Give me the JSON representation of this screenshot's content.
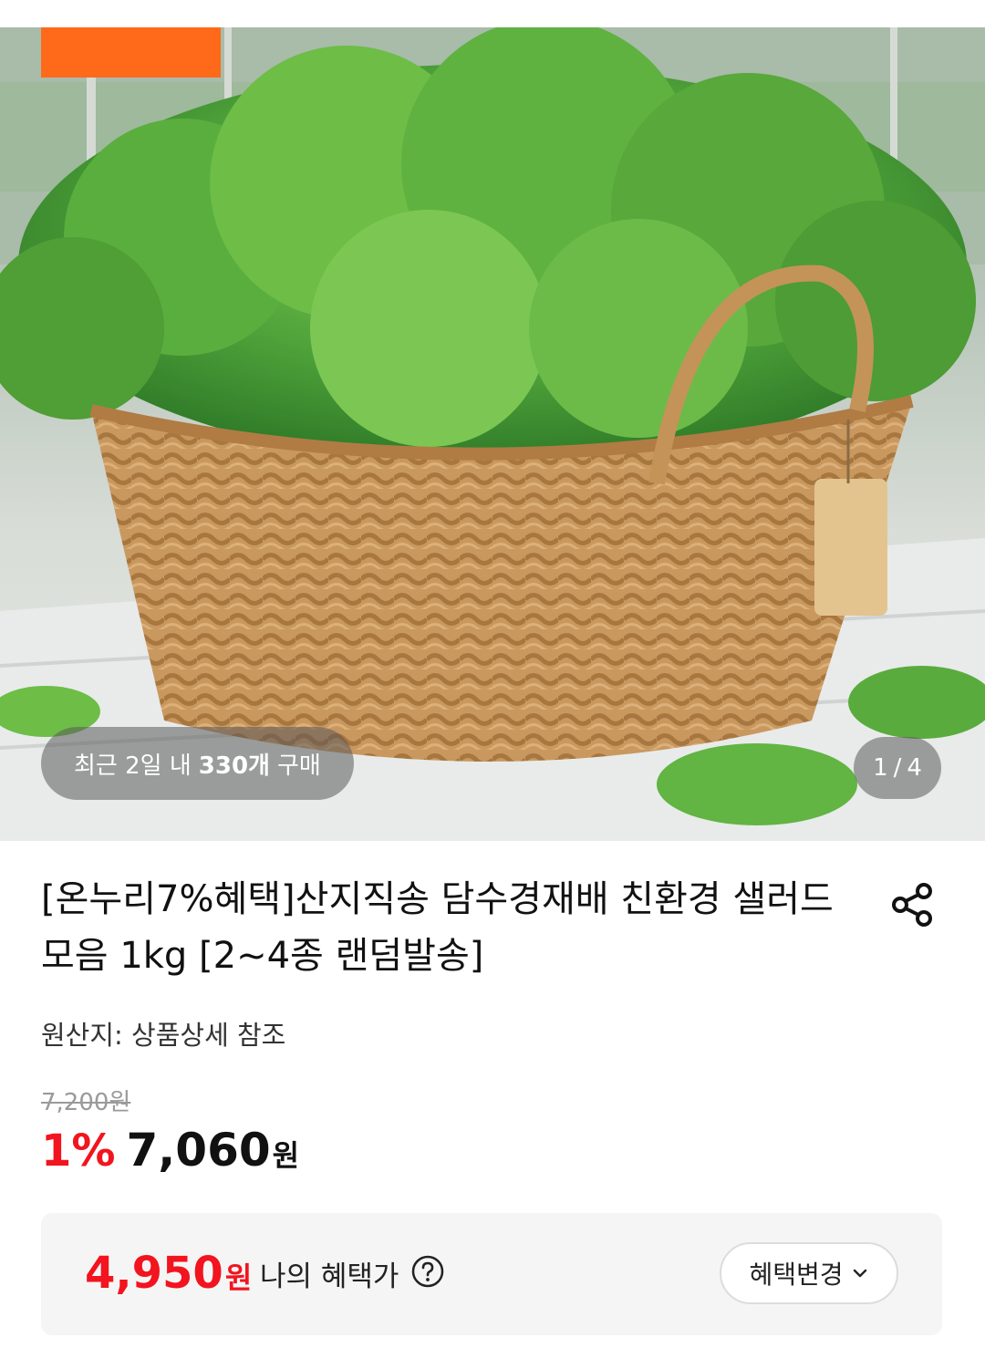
{
  "hero": {
    "image_alt": "Lettuce in a wicker basket",
    "purchase": {
      "prefix": "최근 2일 내",
      "count": "330개",
      "suffix": "구매"
    },
    "counter": {
      "current": "1",
      "separator": "/",
      "total": "4"
    }
  },
  "product": {
    "title": "[온누리7%혜택]산지직송 담수경재배 친환경 샐러드 모음 1kg [2~4종 랜덤발송]",
    "origin": "원산지: 상품상세 참조",
    "original_price": "7,200원",
    "discount_rate": "1%",
    "price": "7,060",
    "currency": "원"
  },
  "benefit": {
    "price": "4,950",
    "currency": "원",
    "label": "나의 혜택가",
    "change_label": "혜택변경"
  },
  "colors": {
    "accent": "#f2141e",
    "promo_badge": "#ff6a1a"
  }
}
